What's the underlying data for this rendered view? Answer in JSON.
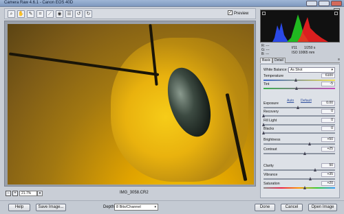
{
  "window": {
    "title": "Camera Raw 4.6.1  -  Canon EOS 40D"
  },
  "toolbar": {
    "tools": [
      "zoom-icon",
      "hand-icon",
      "white-balance-icon",
      "crop-icon",
      "straighten-icon",
      "redeye-icon",
      "preferences-icon",
      "rotate-left-icon",
      "rotate-right-icon"
    ],
    "preview_label": "Preview",
    "preview_checked": true,
    "preview_mark": "✓"
  },
  "image": {
    "zoom": "21.7%",
    "filename": "IMG_3058.CR2"
  },
  "histogram": {
    "colors": [
      "#2e50ff",
      "#22cc22",
      "#ff2222"
    ]
  },
  "readout": {
    "r": "R:   ---",
    "g": "G:   ---",
    "b": "B:   ---",
    "aperture": "f/11",
    "shutter": "1/250 s",
    "iso": "ISO 100",
    "focal": "65 mm"
  },
  "tabs": {
    "basic": "Basic",
    "detail": "Detail"
  },
  "basic": {
    "white_balance_label": "White Balance:",
    "white_balance_value": "As Shot",
    "auto_label": "Auto",
    "default_label": "Default",
    "sliders": [
      {
        "key": "temperature",
        "label": "Temperature",
        "value": "6100",
        "pos": 0.47
      },
      {
        "key": "tint",
        "label": "Tint",
        "value": "-5",
        "pos": 0.48
      },
      {
        "key": "exposure",
        "label": "Exposure",
        "value": "0.00",
        "pos": 0.5
      },
      {
        "key": "recovery",
        "label": "Recovery",
        "value": "0",
        "pos": 0.0
      },
      {
        "key": "fill_light",
        "label": "Fill Light",
        "value": "0",
        "pos": 0.0
      },
      {
        "key": "blacks",
        "label": "Blacks",
        "value": "0",
        "pos": 0.0
      },
      {
        "key": "brightness",
        "label": "Brightness",
        "value": "+50",
        "pos": 0.67
      },
      {
        "key": "contrast",
        "label": "Contrast",
        "value": "+25",
        "pos": 0.6
      },
      {
        "key": "clarity",
        "label": "Clarity",
        "value": "50",
        "pos": 0.75
      },
      {
        "key": "vibrance",
        "label": "Vibrance",
        "value": "+35",
        "pos": 0.68
      },
      {
        "key": "saturation",
        "label": "Saturation",
        "value": "+20",
        "pos": 0.6
      }
    ]
  },
  "footer": {
    "help": "Help",
    "save_image": "Save Image...",
    "depth_label": "Depth:",
    "depth_value": "8 Bits/Channel",
    "done": "Done",
    "cancel": "Cancel",
    "open_image": "Open Image"
  }
}
